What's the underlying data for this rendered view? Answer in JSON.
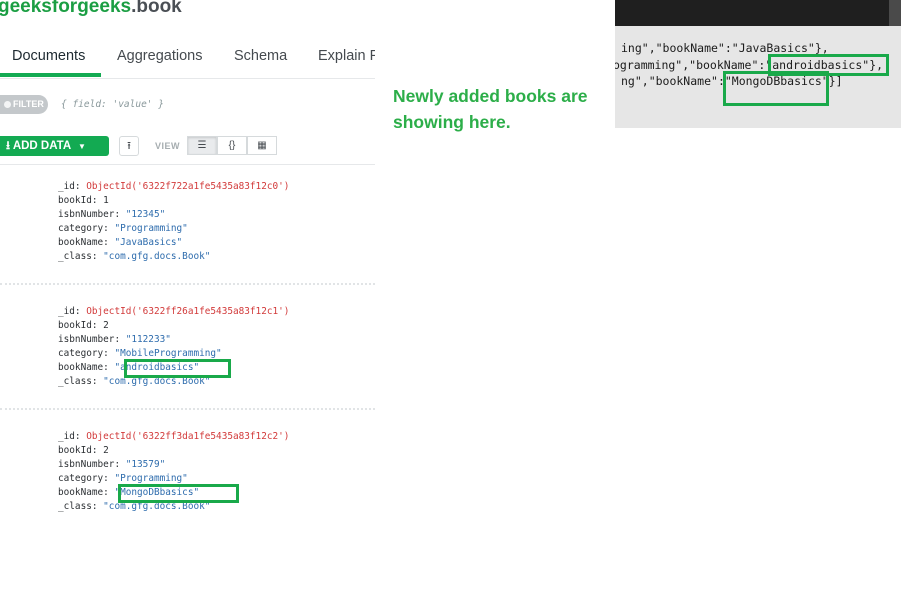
{
  "header": {
    "db": "geeksforgeeks",
    "collection": ".book"
  },
  "tabs": [
    {
      "label": "Documents",
      "active": true
    },
    {
      "label": "Aggregations",
      "active": false
    },
    {
      "label": "Schema",
      "active": false
    },
    {
      "label": "Explain P",
      "active": false
    }
  ],
  "filter": {
    "label": "FILTER",
    "placeholder": "{ field: 'value' }"
  },
  "toolbar": {
    "add_data_label": "ADD DATA",
    "view_label": "VIEW",
    "export_icon": "upload-icon",
    "views": [
      "list-view-icon",
      "json-view-icon",
      "table-view-icon"
    ]
  },
  "documents": [
    {
      "id_text": "ObjectId('6322f722a1fe5435a83f12c0')",
      "bookId": "1",
      "isbnNumber": "\"12345\"",
      "category": "\"Programming\"",
      "bookName": "\"JavaBasics\"",
      "class": "\"com.gfg.docs.Book\""
    },
    {
      "id_text": "ObjectId('6322ff26a1fe5435a83f12c1')",
      "bookId": "2",
      "isbnNumber": "\"112233\"",
      "category": "\"MobileProgramming\"",
      "bookName": "\"androidbasics\"",
      "class": "\"com.gfg.docs.Book\""
    },
    {
      "id_text": "ObjectId('6322ff3da1fe5435a83f12c2')",
      "bookId": "2",
      "isbnNumber": "\"13579\"",
      "category": "\"Programming\"",
      "bookName": "\"MongoDBbasics\"",
      "class": "\"com.gfg.docs.Book\""
    }
  ],
  "keys": {
    "id": "_id: ",
    "bookId": "bookId: ",
    "isbnNumber": "isbnNumber: ",
    "category": "category: ",
    "bookName": "bookName: ",
    "class": "_class: "
  },
  "annotation": {
    "line1": "Newly added books are",
    "line2": "showing here."
  },
  "console": {
    "line1": "ing\",\"bookName\":\"JavaBasics\"},",
    "line2_prefix": "ogramming\",\"bookName\"",
    "line2_value": ":\"androidbasics\"",
    "line2_suffix": "},",
    "line3_prefix": "ng\",\"bookName\"",
    "line3_value": ":\"MongoDBbasics\"",
    "line3_suffix": "}]"
  },
  "colors": {
    "accent": "#13aa52",
    "highlight_box": "#19a94a",
    "annotation": "#2cae49",
    "object_id": "#d23a3a",
    "string_value": "#2e6cad"
  }
}
